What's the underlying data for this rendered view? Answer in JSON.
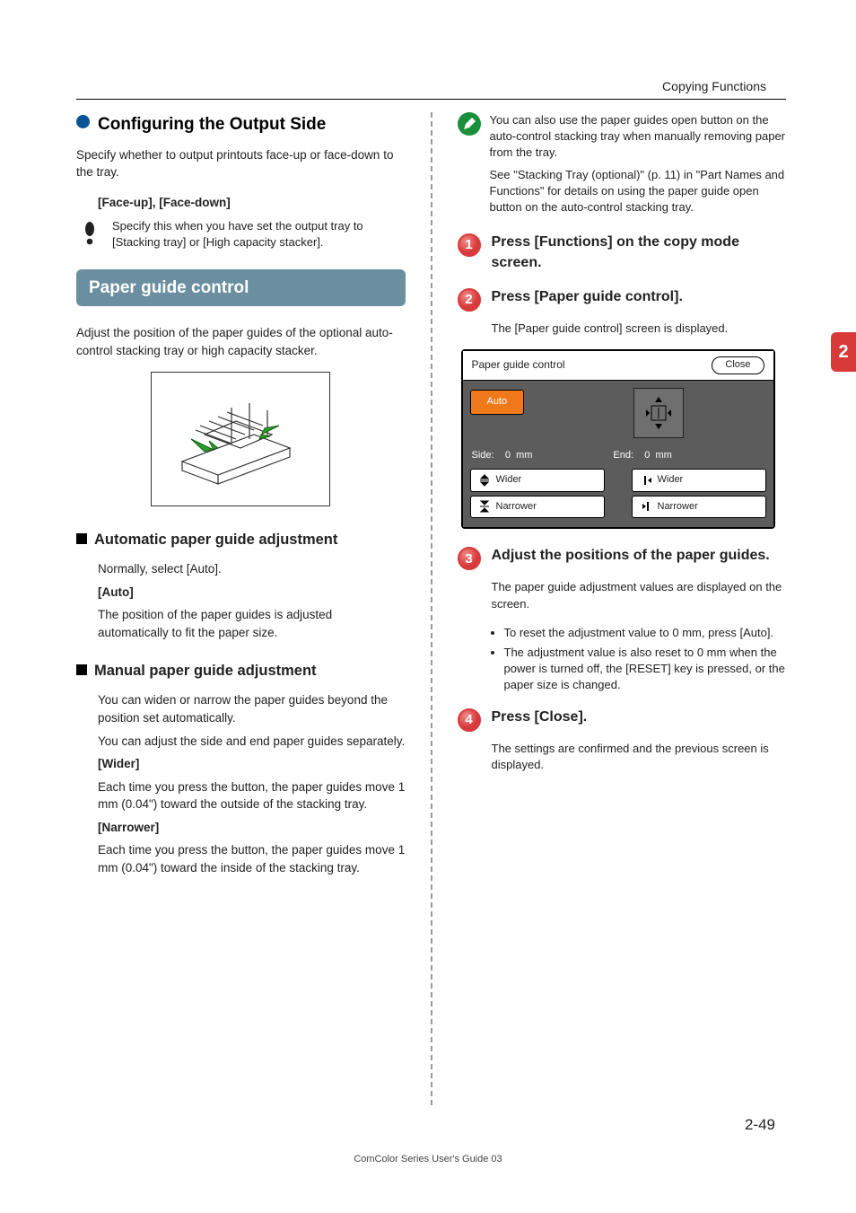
{
  "header": {
    "breadcrumb": "Copying Functions"
  },
  "side_tab": "2",
  "left": {
    "h1": "Configuring the Output Side",
    "intro": "Specify whether to output printouts face-up or face-down to the tray.",
    "options_label": "[Face-up], [Face-down]",
    "note": "Specify this when you have set the output tray to [Stacking tray] or [High capacity stacker].",
    "h2": "Paper guide control",
    "h2_intro": "Adjust the position of the paper guides of the optional auto-control stacking tray or high capacity stacker.",
    "auto": {
      "title": "Automatic paper guide adjustment",
      "p1": "Normally, select [Auto].",
      "label": "[Auto]",
      "p2": "The position of the paper guides is adjusted automatically to fit the paper size."
    },
    "manual": {
      "title": "Manual paper guide adjustment",
      "p1": "You can widen or narrow the paper guides beyond the position set automatically.",
      "p2": "You can adjust the side and end paper guides separately.",
      "wider_label": "[Wider]",
      "wider_text": "Each time you press the button, the paper guides move 1 mm (0.04\") toward the outside of the stacking tray.",
      "narrower_label": "[Narrower]",
      "narrower_text": "Each time you press the button, the paper guides move 1 mm (0.04\") toward the inside of the stacking tray."
    }
  },
  "right": {
    "tip1": "You can also use the paper guides open button on the auto-control stacking tray when manually removing paper from the tray.",
    "tip2": "See \"Stacking Tray (optional)\" (p. 11) in \"Part Names and Functions\" for details on using the paper guide open button on the auto-control stacking tray.",
    "steps": [
      {
        "n": "1",
        "title": "Press [Functions] on the copy mode screen."
      },
      {
        "n": "2",
        "title": "Press [Paper guide control].",
        "body": "The [Paper guide control] screen is displayed."
      },
      {
        "n": "3",
        "title": "Adjust the positions of the paper guides.",
        "body": "The paper guide adjustment values are displayed on the screen."
      },
      {
        "n": "4",
        "title": "Press [Close].",
        "body": "The settings are confirmed and the previous screen is displayed."
      }
    ],
    "step3_bullets": [
      "To reset the adjustment value to 0 mm, press [Auto].",
      "The adjustment value is also reset to 0 mm when the power is turned off, the [RESET] key is pressed, or the paper size is changed."
    ],
    "screen": {
      "title": "Paper guide control",
      "close": "Close",
      "auto": "Auto",
      "side_label": "Side:",
      "side_val": "0",
      "side_unit": "mm",
      "end_label": "End:",
      "end_val": "0",
      "end_unit": "mm",
      "wider": "Wider",
      "narrower": "Narrower"
    }
  },
  "page_number": "2-49",
  "footer": "ComColor Series User's Guide 03"
}
